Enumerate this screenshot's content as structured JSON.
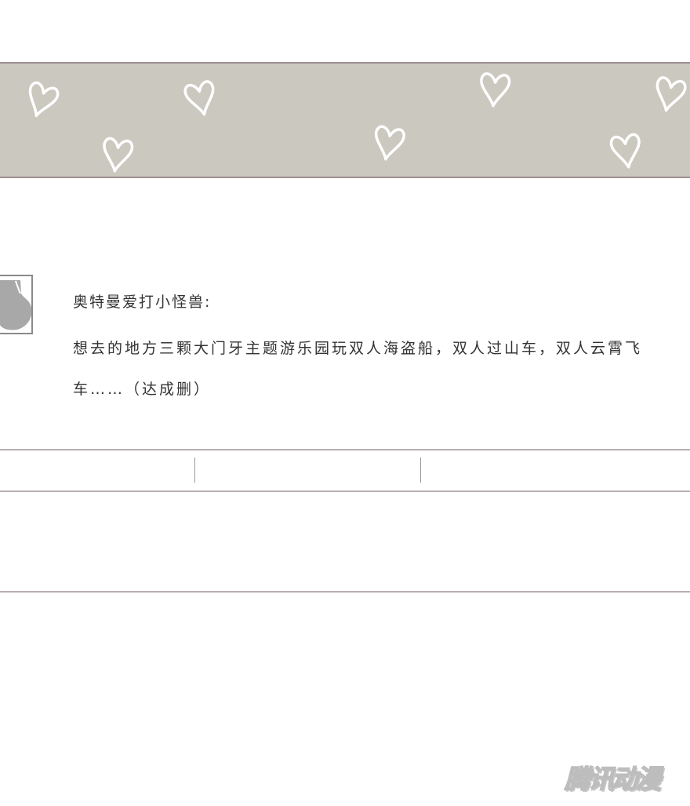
{
  "comment": {
    "username": "奥特曼爱打小怪兽:",
    "text": "想去的地方三颗大门牙主题游乐园玩双人海盗船，双人过山车，双人云霄飞车……（达成删）"
  },
  "watermark": "腾讯动漫",
  "colors": {
    "banner": "#cbc8bf",
    "banner_border": "#9e8f93",
    "divider": "#b9adb1",
    "text": "#333333"
  },
  "icons": [
    "heart-icon",
    "avatar-icon"
  ]
}
